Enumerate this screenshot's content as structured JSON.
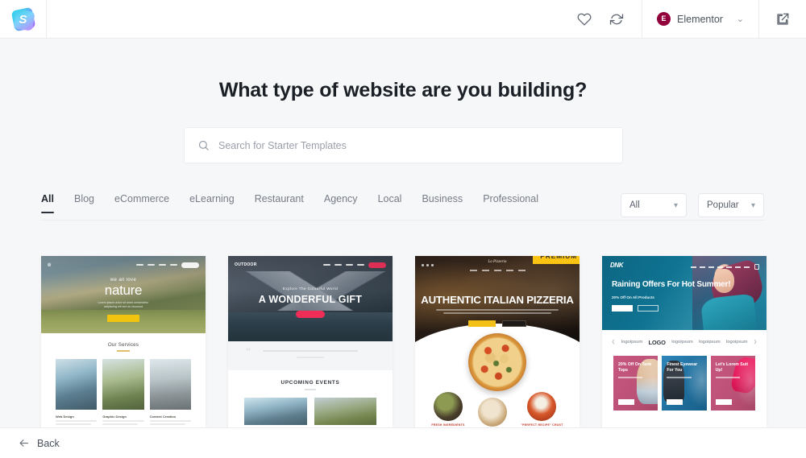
{
  "header": {
    "logo_name": "starter-templates-logo",
    "logo_letter": "S",
    "icons": [
      {
        "name": "favorites-heart-icon",
        "label": "Favorites"
      },
      {
        "name": "sync-refresh-icon",
        "label": "Sync Library"
      }
    ],
    "builder": {
      "badge_letter": "E",
      "name": "Elementor",
      "chevron": "⌄"
    },
    "external_link_name": "open-in-new-tab-icon"
  },
  "page": {
    "title": "What type of website are you building?"
  },
  "search": {
    "placeholder": "Search for Starter Templates",
    "value": "",
    "icon_name": "search-icon"
  },
  "filters": {
    "tabs": [
      {
        "label": "All",
        "active": true
      },
      {
        "label": "Blog",
        "active": false
      },
      {
        "label": "eCommerce",
        "active": false
      },
      {
        "label": "eLearning",
        "active": false
      },
      {
        "label": "Restaurant",
        "active": false
      },
      {
        "label": "Agency",
        "active": false
      },
      {
        "label": "Local",
        "active": false
      },
      {
        "label": "Business",
        "active": false
      },
      {
        "label": "Professional",
        "active": false
      }
    ],
    "selects": [
      {
        "name": "type-filter",
        "value": "All"
      },
      {
        "name": "sort-filter",
        "value": "Popular"
      }
    ]
  },
  "templates": [
    {
      "id": "nature",
      "premium": false,
      "hero_eyebrow": "we all love",
      "hero_title": "nature",
      "section_title": "Our Services",
      "services": [
        "Web Design",
        "Graphic Design",
        "Content Creation"
      ]
    },
    {
      "id": "outdoor",
      "premium": false,
      "brand": "OUTDOOR",
      "hero_eyebrow": "Explore The Colourful World",
      "hero_title": "A WONDERFUL GIFT",
      "section_title": "UPCOMING EVENTS"
    },
    {
      "id": "pizzeria",
      "premium": true,
      "premium_label": "PREMIUM",
      "brand": "La Pizzeria",
      "hero_title": "AUTHENTIC ITALIAN PIZZERIA",
      "features": [
        "FRESH INGREDIENTS",
        "",
        "\"PERFECT RECIPE\" CRUST"
      ]
    },
    {
      "id": "dnk",
      "premium": false,
      "brand": "DNK",
      "hero_title": "Raining Offers For Hot Summer!",
      "hero_sub": "20% Off On All Products",
      "logos": [
        "logoipsum",
        "LOGO",
        "logoipsum",
        "logoipsum",
        "logoipsum"
      ],
      "promos": [
        "20% Off On Tank Tops",
        "Finest Eyewear For You",
        "Let's Lorem Suit Up!"
      ]
    }
  ],
  "footer": {
    "back_label": "Back",
    "back_icon": "arrow-left-icon"
  },
  "colors": {
    "premium_badge": "#fbc412",
    "elementor": "#92003b",
    "page_bg": "#f6f7f8",
    "accent_dark": "#2b313c"
  }
}
